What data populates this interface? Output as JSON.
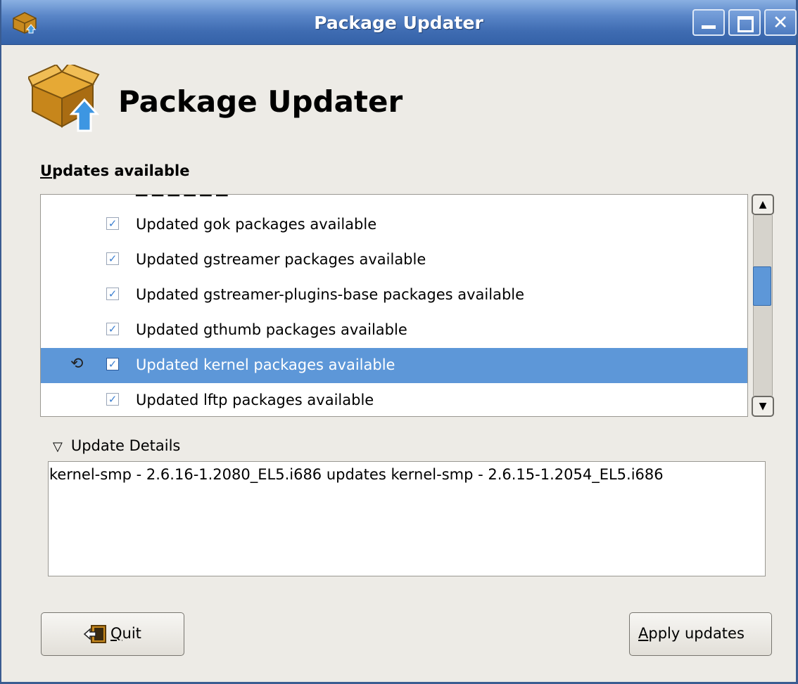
{
  "window": {
    "title": "Package Updater",
    "icons": [
      "package-updater-icon",
      "minimize-icon",
      "maximize-icon",
      "close-icon"
    ]
  },
  "header": {
    "title": "Package Updater",
    "icon": "package-box-icon"
  },
  "updates": {
    "label_accel": "U",
    "label_rest": "pdates available",
    "items": [
      {
        "label": "Updated gok packages available",
        "checked": true
      },
      {
        "label": "Updated gstreamer packages available",
        "checked": true
      },
      {
        "label": "Updated gstreamer-plugins-base packages available",
        "checked": true
      },
      {
        "label": "Updated gthumb packages available",
        "checked": true
      },
      {
        "label": "Updated kernel packages available",
        "checked": true,
        "selected": true
      },
      {
        "label": "Updated lftp packages available",
        "checked": true
      }
    ],
    "checkmark": "✓",
    "busy_glyph": "⟲"
  },
  "details": {
    "expander_glyph": "▽",
    "expander_label": "Update Details",
    "text": "kernel-smp - 2.6.16-1.2080_EL5.i686 updates kernel-smp - 2.6.15-1.2054_EL5.i686"
  },
  "buttons": {
    "quit_accel": "Q",
    "quit_rest": "uit",
    "apply_accel": "A",
    "apply_rest": "pply updates"
  },
  "colors": {
    "selection": "#5d97d8",
    "titlebar": "#3f6cb2",
    "background": "#edebe6"
  }
}
